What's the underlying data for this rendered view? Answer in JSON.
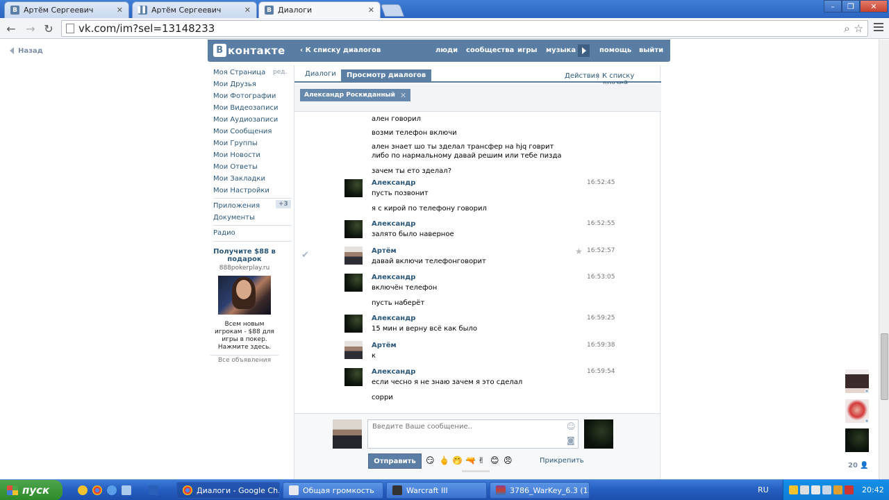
{
  "browser": {
    "tabs": [
      {
        "label": "Артём Сергеевич",
        "icon": "vk-icon"
      },
      {
        "label": "Артём Сергеевич",
        "icon": "pause-icon"
      },
      {
        "label": "Диалоги",
        "icon": "vk-icon"
      }
    ],
    "url": "vk.com/im?sel=13148233"
  },
  "page": {
    "back_label": "Назад",
    "logo_text": "контакте",
    "logo_letter": "В",
    "back_to_dialogs": "К списку диалогов",
    "nav": [
      "люди",
      "сообщества",
      "игры",
      "музыка",
      "помощь",
      "выйти"
    ]
  },
  "leftmenu": {
    "edit": "ред.",
    "items": [
      "Моя Страница",
      "Мои Друзья",
      "Мои Фотографии",
      "Мои Видеозаписи",
      "Мои Аудиозаписи",
      "Мои Сообщения",
      "Мои Группы",
      "Мои Новости",
      "Мои Ответы",
      "Мои Закладки",
      "Мои Настройки"
    ],
    "apps": "Приложения",
    "apps_badge": "+3",
    "docs": "Документы",
    "radio": "Радио"
  },
  "ad": {
    "title": "Получите $88 в подарок",
    "domain": "888pokerplay.ru",
    "text": "Всем новым игрокам - $88 для игры в покер. Нажмите здесь.",
    "all": "Все объявления"
  },
  "main": {
    "tab_dialogs": "Диалоги",
    "tab_view": "Просмотр диалогов",
    "actions": "Действия",
    "sep": "|",
    "to_friends": "К списку друзей",
    "peer": "Александр Роскиданный"
  },
  "messages": [
    {
      "text": "ален говорил"
    },
    {
      "text": "возми телефон включи"
    },
    {
      "text": "ален знает шо ты зделал трансфер на hjq говрит либо по нармальному давай решим или тебе пизда"
    },
    {
      "text": "зачем ты ето зделал?"
    },
    {
      "author": "Александр",
      "time": "16:52:45",
      "text": "пусть позвонит"
    },
    {
      "text": "я с кирой по телефону говорил"
    },
    {
      "author": "Александр",
      "time": "16:52:55",
      "text": "залято было наверное"
    },
    {
      "author": "Артём",
      "time": "16:52:57",
      "text": "давай включи телефонговорит"
    },
    {
      "author": "Александр",
      "time": "16:53:05",
      "text": "включён телефон"
    },
    {
      "text": "пусть наберёт"
    },
    {
      "author": "Александр",
      "time": "16:59:25",
      "text": "15 мин и верну всё как было"
    },
    {
      "author": "Артём",
      "time": "16:59:38",
      "text": "к"
    },
    {
      "author": "Александр",
      "time": "16:59:54",
      "text": "если чесно я не знаю зачем я это сделал"
    },
    {
      "text": "сорри"
    }
  ],
  "composer": {
    "placeholder": "Введите Ваше сообщение..",
    "send": "Отправить",
    "attach": "Прикрепить",
    "emojis": [
      "😏",
      "🖕",
      "🤭",
      "🔫",
      "✌",
      "😊",
      "😠"
    ]
  },
  "rail": {
    "count": "20"
  },
  "taskbar": {
    "start": "пуск",
    "tasks": [
      "Диалоги - Google Ch...",
      "Общая громкость",
      "Warcraft III",
      "3786_WarKey_6.3 (1..."
    ],
    "lang": "RU",
    "clock": "20:42"
  }
}
